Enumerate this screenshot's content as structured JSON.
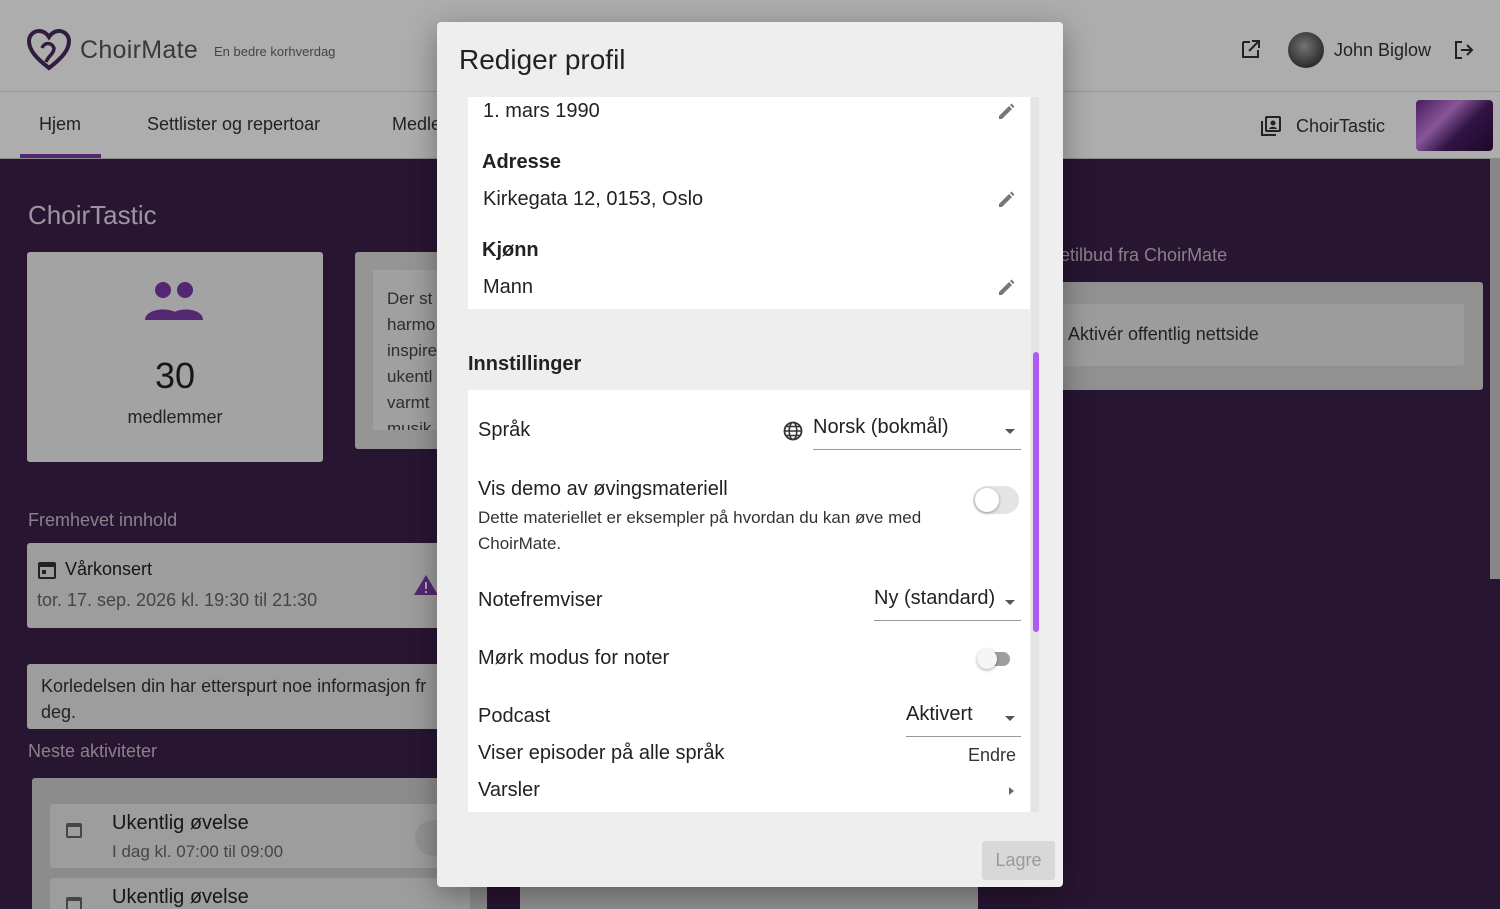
{
  "header": {
    "brand": "ChoirMate",
    "tagline": "En bedre korhverdag",
    "user_name": "John Biglow"
  },
  "nav": {
    "tabs": [
      "Hjem",
      "Settlister og repertoar",
      "Medle"
    ],
    "choir_name": "ChoirTastic"
  },
  "dashboard": {
    "title": "ChoirTastic",
    "members_count": "30",
    "members_label": "medlemmer",
    "intro_lines": [
      "Der st",
      "harmo",
      "inspire",
      "ukentl",
      "varmt",
      "musik"
    ],
    "featured_heading": "Fremhevet innhold",
    "featured_event_title": "Vårkonsert",
    "featured_event_time": "tor. 17. sep. 2026 kl. 19:30 til 21:30",
    "info_message": "Korledelsen din har etterspurt noe informasjon fra deg.",
    "info_message_visible": "Korledelsen din har etterspurt noe informasjon fr deg.",
    "upcoming_heading": "Neste aktiviteter",
    "activities": [
      {
        "title": "Ukentlig øvelse",
        "time": "I dag kl. 07:00 til 09:00"
      },
      {
        "title": "Ukentlig øvelse",
        "time": ""
      }
    ],
    "offers_heading": "etilbud fra ChoirMate",
    "offer_item": "Aktivér offentlig nettside"
  },
  "dialog": {
    "title": "Rediger profil",
    "birthdate_value": "1. mars 1990",
    "address_label": "Adresse",
    "address_value": "Kirkegata 12, 0153, Oslo",
    "gender_label": "Kjønn",
    "gender_value": "Mann",
    "settings_heading": "Innstillinger",
    "language_label": "Språk",
    "language_value": "Norsk (bokmål)",
    "demo_label": "Vis demo av øvingsmateriell",
    "demo_description": "Dette materiellet er eksempler på hvordan du kan øve med ChoirMate.",
    "demo_enabled": false,
    "sheet_viewer_label": "Notefremviser",
    "sheet_viewer_value": "Ny (standard)",
    "dark_mode_label": "Mørk modus for noter",
    "dark_mode_enabled": false,
    "podcast_label": "Podcast",
    "podcast_value": "Aktivert",
    "podcast_languages": "Viser episoder på alle språk",
    "change_label": "Endre",
    "notifications_label": "Varsler",
    "save_label": "Lagre"
  },
  "colors": {
    "accent": "#7c3aa8",
    "scrollbar": "#b05bf0",
    "background": "#3c1f4a"
  }
}
